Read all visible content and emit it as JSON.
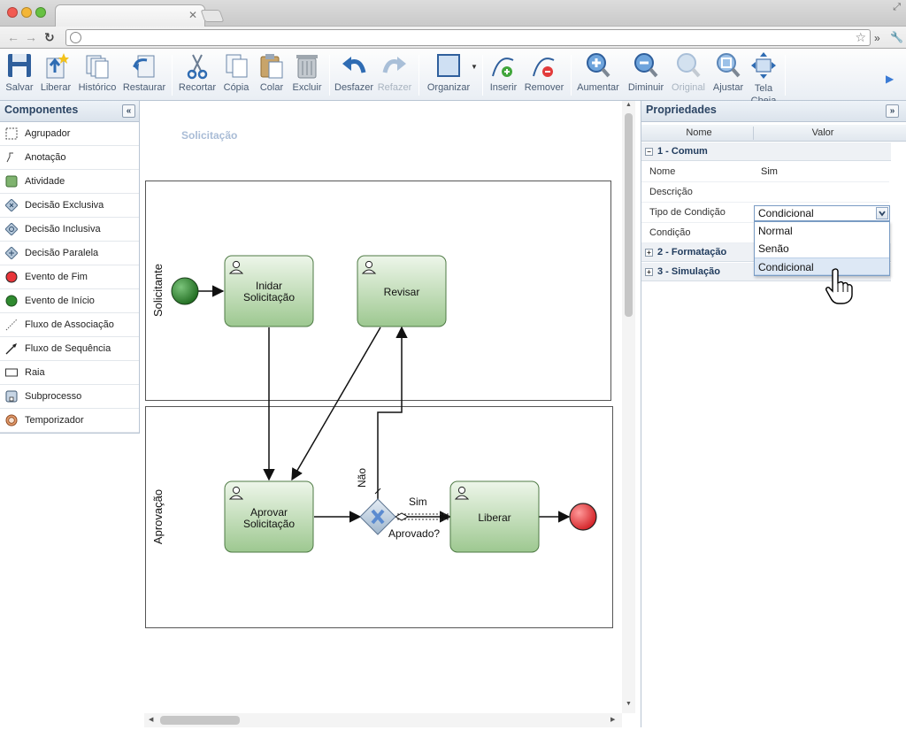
{
  "browser": {
    "colors": {
      "close": "#f25b52",
      "minimize": "#f3b637",
      "zoom": "#67c142"
    }
  },
  "toolbar": {
    "buttons": [
      {
        "label": "Salvar",
        "icon": "floppy-icon"
      },
      {
        "label": "Liberar",
        "icon": "upload-icon"
      },
      {
        "label": "Histórico",
        "icon": "history-icon"
      },
      {
        "label": "Restaurar",
        "icon": "restore-icon"
      },
      {
        "label": "Recortar",
        "icon": "scissors-icon"
      },
      {
        "label": "Cópia",
        "icon": "copy-icon"
      },
      {
        "label": "Colar",
        "icon": "paste-icon"
      },
      {
        "label": "Excluir",
        "icon": "trash-icon"
      },
      {
        "label": "Desfazer",
        "icon": "undo-icon"
      },
      {
        "label": "Refazer",
        "icon": "redo-icon"
      },
      {
        "label": "Organizar",
        "icon": "arrange-icon"
      },
      {
        "label": "Inserir",
        "icon": "insert-point-icon"
      },
      {
        "label": "Remover",
        "icon": "remove-point-icon"
      },
      {
        "label": "Aumentar",
        "icon": "zoom-in-icon"
      },
      {
        "label": "Diminuir",
        "icon": "zoom-out-icon"
      },
      {
        "label": "Original",
        "icon": "zoom-actual-icon"
      },
      {
        "label": "Ajustar",
        "icon": "zoom-fit-icon"
      },
      {
        "label": "Tela Cheia",
        "icon": "fullscreen-icon"
      }
    ]
  },
  "components": {
    "title": "Componentes",
    "collapse": "«",
    "items": [
      {
        "label": "Agrupador",
        "icon": "group-icon"
      },
      {
        "label": "Anotação",
        "icon": "annotation-icon"
      },
      {
        "label": "Atividade",
        "icon": "activity-icon"
      },
      {
        "label": "Decisão Exclusiva",
        "icon": "exclusive-gateway-icon"
      },
      {
        "label": "Decisão Inclusiva",
        "icon": "inclusive-gateway-icon"
      },
      {
        "label": "Decisão Paralela",
        "icon": "parallel-gateway-icon"
      },
      {
        "label": "Evento de Fim",
        "icon": "end-event-icon"
      },
      {
        "label": "Evento de Início",
        "icon": "start-event-icon"
      },
      {
        "label": "Fluxo de Associação",
        "icon": "association-flow-icon"
      },
      {
        "label": "Fluxo de Sequência",
        "icon": "sequence-flow-icon"
      },
      {
        "label": "Raia",
        "icon": "lane-icon"
      },
      {
        "label": "Subprocesso",
        "icon": "subprocess-icon"
      },
      {
        "label": "Temporizador",
        "icon": "timer-icon"
      }
    ]
  },
  "diagram": {
    "pool_title": "Solicitação",
    "lanes": [
      "Solicitante",
      "Aprovação"
    ],
    "tasks": {
      "iniciar_line1": "Inidar",
      "iniciar_line2": "Solicitação",
      "revisar": "Revisar",
      "aprovar_line1": "Aprovar",
      "aprovar_line2": "Solicitação",
      "liberar": "Liberar"
    },
    "gateway_label": "Aprovado?",
    "flow_labels": {
      "sim": "Sim",
      "nao": "Não"
    },
    "colors": {
      "task_top": "#eef6ea",
      "task_bottom": "#9dc890",
      "start": "#2f8a2f",
      "end": "#e8353a"
    }
  },
  "properties": {
    "title": "Propriedades",
    "collapse": "»",
    "columns": {
      "name": "Nome",
      "value": "Valor"
    },
    "groups": {
      "comum": "1 - Comum",
      "formatacao": "2 - Formatação",
      "simulacao": "3 - Simulação"
    },
    "rows": {
      "nome": {
        "label": "Nome",
        "value": "Sim"
      },
      "descricao": {
        "label": "Descrição",
        "value": ""
      },
      "tipo": {
        "label": "Tipo de Condição",
        "value": "Condicional"
      },
      "condicao": {
        "label": "Condição",
        "value": ""
      }
    },
    "dropdown_options": [
      "Normal",
      "Senão",
      "Condicional"
    ],
    "selected_option": "Condicional"
  }
}
